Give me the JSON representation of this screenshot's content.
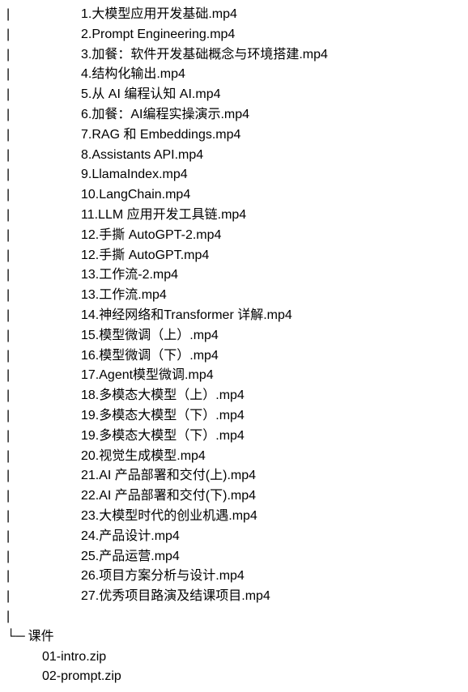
{
  "tree": {
    "pipe_char": "|",
    "corner_char": "└─",
    "videos": [
      "1.大模型应用开发基础.mp4",
      "2.Prompt Engineering.mp4",
      "3.加餐：软件开发基础概念与环境搭建.mp4",
      "4.结构化输出.mp4",
      "5.从 AI 编程认知 AI.mp4",
      "6.加餐：AI编程实操演示.mp4",
      "7.RAG 和 Embeddings.mp4",
      "8.Assistants API.mp4",
      "9.LlamaIndex.mp4",
      "10.LangChain.mp4",
      "11.LLM 应用开发工具链.mp4",
      "12.手撕 AutoGPT-2.mp4",
      "12.手撕 AutoGPT.mp4",
      "13.工作流-2.mp4",
      "13.工作流.mp4",
      "14.神经网络和Transformer 详解.mp4",
      "15.模型微调（上）.mp4",
      "16.模型微调（下）.mp4",
      "17.Agent模型微调.mp4",
      "18.多模态大模型（上）.mp4",
      "19.多模态大模型（下）.mp4",
      "19.多模态大模型（下）.mp4",
      "20.视觉生成模型.mp4",
      "21.AI 产品部署和交付(上).mp4",
      "22.AI 产品部署和交付(下).mp4",
      "23.大模型时代的创业机遇.mp4",
      "24.产品设计.mp4",
      "25.产品运营.mp4",
      "26.项目方案分析与设计.mp4",
      "27.优秀项目路演及结课项目.mp4"
    ],
    "child_dir": {
      "name": "课件",
      "files": [
        "01-intro.zip",
        "02-prompt.zip"
      ]
    }
  }
}
